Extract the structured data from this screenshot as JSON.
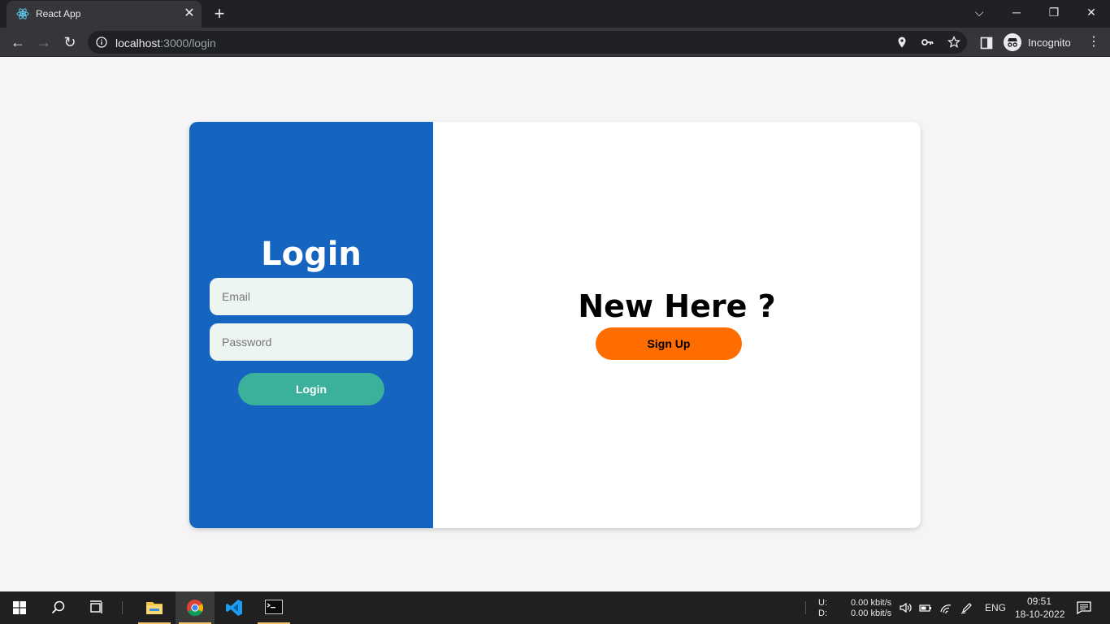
{
  "browser": {
    "tab_title": "React App",
    "url_host": "localhost",
    "url_path": ":3000/login",
    "profile_label": "Incognito"
  },
  "page": {
    "login_title": "Login",
    "email_placeholder": "Email",
    "password_placeholder": "Password",
    "login_button": "Login",
    "new_here": "New Here ?",
    "signup_button": "Sign Up"
  },
  "colors": {
    "left_panel": "#1565c0",
    "login_button": "#3bb19b",
    "signup_button": "#ff6d00",
    "input_bg": "#edf5f3"
  },
  "taskbar": {
    "net_up_label": "U:",
    "net_down_label": "D:",
    "net_up_value": "0.00 kbit/s",
    "net_down_value": "0.00 kbit/s",
    "lang": "ENG",
    "time": "09:51",
    "date": "18-10-2022",
    "apps": [
      "file-explorer-icon",
      "chrome-icon",
      "vscode-icon",
      "terminal-icon"
    ]
  }
}
